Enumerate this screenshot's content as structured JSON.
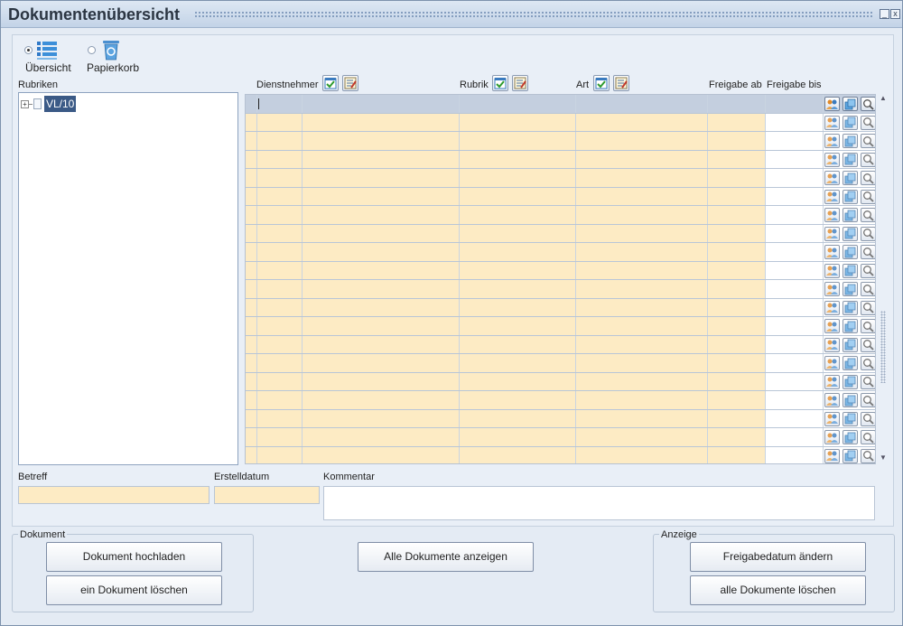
{
  "window": {
    "title": "Dokumentenübersicht",
    "minimize_label": "_",
    "close_label": "x"
  },
  "view_options": [
    {
      "label": "Übersicht",
      "selected": true,
      "icon": "list-icon"
    },
    {
      "label": "Papierkorb",
      "selected": false,
      "icon": "recycle-bin-icon"
    }
  ],
  "tree": {
    "label": "Rubriken",
    "nodes": [
      {
        "label": "VL/10",
        "expand_symbol": "+",
        "selected": true
      }
    ]
  },
  "grid": {
    "columns": [
      {
        "label": "Dienstnehmer",
        "has_icons": true
      },
      {
        "label": "Rubrik",
        "has_icons": true
      },
      {
        "label": "Art",
        "has_icons": true
      },
      {
        "label": "Freigabe ab",
        "has_icons": false
      },
      {
        "label": "Freigabe bis",
        "has_icons": false
      }
    ],
    "header_icons": [
      "checklist-icon",
      "edit-list-icon"
    ],
    "row_count": 20,
    "selected_row": 0,
    "row_buttons": [
      "user-group-icon",
      "copy-icon",
      "magnifier-icon"
    ]
  },
  "scrollbar": {
    "up": "▲",
    "down": "▼"
  },
  "details": {
    "betreff_label": "Betreff",
    "betreff_value": "",
    "erstelldatum_label": "Erstelldatum",
    "erstelldatum_value": "",
    "kommentar_label": "Kommentar",
    "kommentar_value": ""
  },
  "dokument_group": {
    "legend": "Dokument",
    "upload_button": "Dokument hochladen",
    "delete_button": "ein Dokument löschen"
  },
  "center_button": "Alle Dokumente anzeigen",
  "anzeige_group": {
    "legend": "Anzeige",
    "change_date_button": "Freigabedatum ändern",
    "delete_all_button": "alle Dokumente löschen"
  },
  "colors": {
    "accent": "#3b5a86",
    "field_yellow": "#fdebc4",
    "selected_row": "#c4cfdf",
    "title_bg": "#c3d3e7"
  }
}
